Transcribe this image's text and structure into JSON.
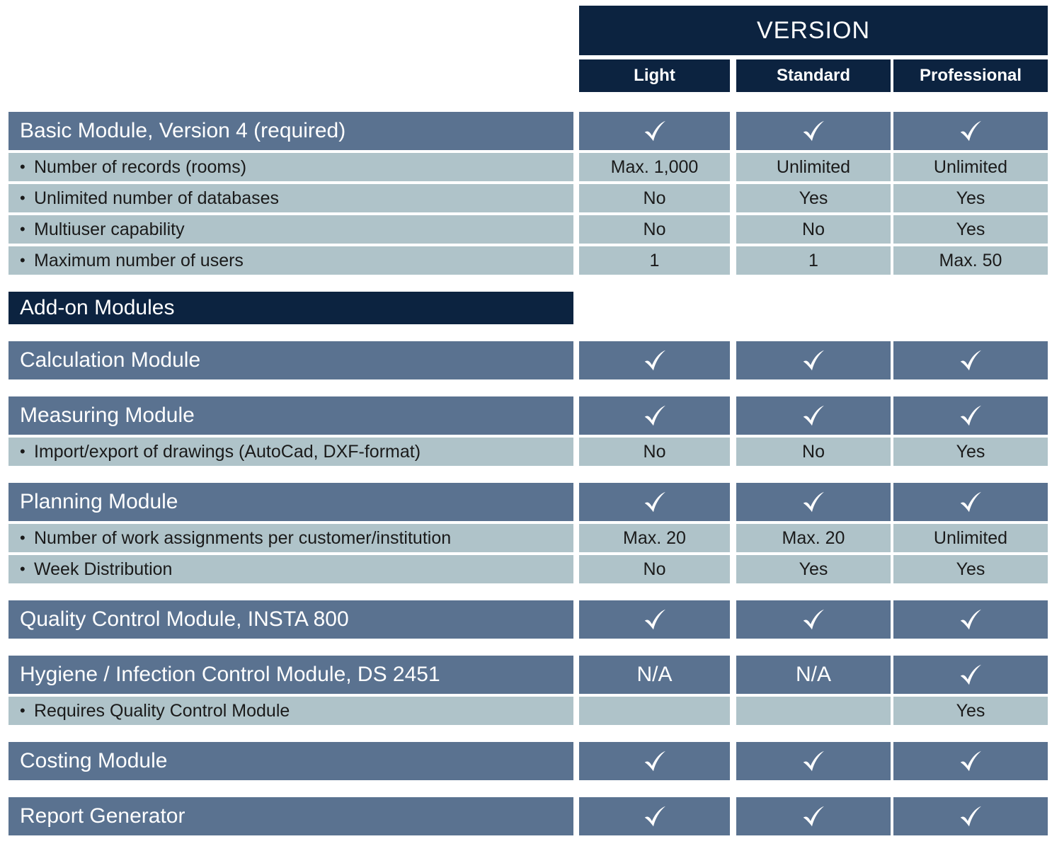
{
  "header": {
    "version_title": "VERSION",
    "columns": [
      "Light",
      "Standard",
      "Professional"
    ]
  },
  "icons": {
    "check": "checkmark-icon"
  },
  "colors": {
    "navy": "#0c2340",
    "module_blue": "#5a7290",
    "sub_row": "#afc3c9",
    "page_background": "#ffffff"
  },
  "sections": [
    {
      "title": "Basic Module, Version 4 (required)",
      "title_values": [
        "check",
        "check",
        "check"
      ],
      "rows": [
        {
          "label": "Number of records (rooms)",
          "values": [
            "Max. 1,000",
            "Unlimited",
            "Unlimited"
          ]
        },
        {
          "label": "Unlimited number of databases",
          "values": [
            "No",
            "Yes",
            "Yes"
          ]
        },
        {
          "label": "Multiuser capability",
          "values": [
            "No",
            "No",
            "Yes"
          ]
        },
        {
          "label": "Maximum number of users",
          "values": [
            "1",
            "1",
            "Max. 50"
          ]
        }
      ]
    },
    {
      "banner": "Add-on Modules"
    },
    {
      "title": "Calculation Module",
      "title_values": [
        "check",
        "check",
        "check"
      ],
      "rows": []
    },
    {
      "title": "Measuring Module",
      "title_values": [
        "check",
        "check",
        "check"
      ],
      "rows": [
        {
          "label": "Import/export of drawings (AutoCad, DXF-format)",
          "values": [
            "No",
            "No",
            "Yes"
          ]
        }
      ]
    },
    {
      "title": "Planning Module",
      "title_values": [
        "check",
        "check",
        "check"
      ],
      "rows": [
        {
          "label": "Number of work assignments per customer/institution",
          "values": [
            "Max. 20",
            "Max. 20",
            "Unlimited"
          ]
        },
        {
          "label": "Week Distribution",
          "values": [
            "No",
            "Yes",
            "Yes"
          ]
        }
      ]
    },
    {
      "title": "Quality Control Module, INSTA 800",
      "title_values": [
        "check",
        "check",
        "check"
      ],
      "rows": []
    },
    {
      "title": "Hygiene / Infection Control Module, DS 2451",
      "title_values": [
        "N/A",
        "N/A",
        "check"
      ],
      "rows": [
        {
          "label": "Requires Quality Control Module",
          "values": [
            "",
            "",
            "Yes"
          ]
        }
      ]
    },
    {
      "title": "Costing Module",
      "title_values": [
        "check",
        "check",
        "check"
      ],
      "rows": []
    },
    {
      "title": "Report Generator",
      "title_values": [
        "check",
        "check",
        "check"
      ],
      "rows": []
    }
  ]
}
